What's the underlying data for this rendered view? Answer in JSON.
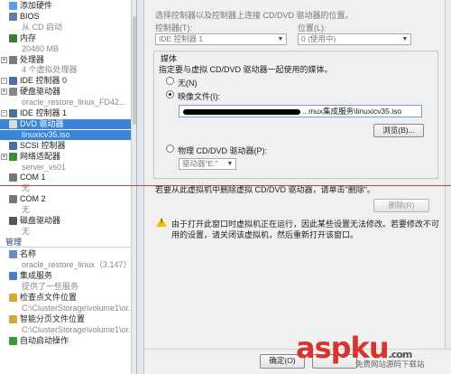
{
  "tree": {
    "items": [
      {
        "label": "添加硬件",
        "icon": "add-hardware-icon",
        "color": "#5aa0e6"
      },
      {
        "label": "BIOS",
        "icon": "bios-icon",
        "color": "#5c7ea8"
      },
      {
        "label": "从 CD 启动",
        "sub": true
      },
      {
        "label": "内存",
        "icon": "memory-icon",
        "color": "#3d7a3d"
      },
      {
        "label": "20480 MB",
        "sub": true
      },
      {
        "label": "处理器",
        "icon": "processor-icon",
        "color": "#7a7a7a",
        "exp": "+"
      },
      {
        "label": "4 个虚拟处理器",
        "sub": true
      },
      {
        "label": "IDE 控制器 0",
        "icon": "ide-controller-icon",
        "color": "#4a6fa0",
        "exp": "-"
      },
      {
        "label": "硬盘驱动器",
        "icon": "hard-drive-icon",
        "color": "#888888",
        "exp": "+"
      },
      {
        "label": "oracle_restore_linux_FD42...",
        "sub": true
      },
      {
        "label": "IDE 控制器 1",
        "icon": "ide-controller-icon",
        "color": "#4a6fa0",
        "exp": "-"
      },
      {
        "label": "DVD 驱动器",
        "icon": "dvd-drive-icon",
        "color": "#dcdcdc",
        "selected": true
      },
      {
        "label": "linuxicv35.iso",
        "sub": true,
        "selected": true
      },
      {
        "label": "SCSI 控制器",
        "icon": "scsi-controller-icon",
        "color": "#4a6fa0"
      },
      {
        "label": "网络适配器",
        "icon": "network-adapter-icon",
        "color": "#3a8a3a",
        "exp": "+"
      },
      {
        "label": "server_vs01",
        "sub": true
      },
      {
        "label": "COM 1",
        "icon": "com-port-icon",
        "color": "#777777"
      },
      {
        "label": "无",
        "sub": true
      },
      {
        "label": "COM 2",
        "icon": "com-port-icon",
        "color": "#777777"
      },
      {
        "label": "无",
        "sub": true
      },
      {
        "label": "磁盘驱动器",
        "icon": "floppy-drive-icon",
        "color": "#555555"
      },
      {
        "label": "无",
        "sub": true
      }
    ],
    "management_title": "管理",
    "management_items": [
      {
        "label": "名称",
        "icon": "name-icon",
        "color": "#6a8cc0"
      },
      {
        "label": "oracle_restore_linux（3.147）",
        "sub": true
      },
      {
        "label": "集成服务",
        "icon": "integration-services-icon",
        "color": "#4a80c8"
      },
      {
        "label": "提供了一些服务",
        "sub": true
      },
      {
        "label": "检查点文件位置",
        "icon": "checkpoint-folder-icon",
        "color": "#d8a93a"
      },
      {
        "label": "C:\\ClusterStorage\\volume1\\or...",
        "sub": true
      },
      {
        "label": "智能分页文件位置",
        "icon": "paging-folder-icon",
        "color": "#d8a93a"
      },
      {
        "label": "C:\\ClusterStorage\\volume1\\or...",
        "sub": true
      },
      {
        "label": "自动启动操作",
        "icon": "autostart-icon",
        "color": "#3a9a3a"
      }
    ]
  },
  "right": {
    "top_instruction": "选择控制器以及控制器上连接 CD/DVD 驱动器的位置。",
    "controller_label": "控制器(T):",
    "controller_value": "IDE 控制器 1",
    "location_label": "位置(L):",
    "location_value": "0 (使用中)",
    "media_title": "媒体",
    "media_instruction": "指定要与虚拟 CD/DVD 驱动器一起使用的媒体。",
    "radio_none": "无(N)",
    "radio_image": "映像文件(I):",
    "image_path": "...mux集成服务\\linuxicv35.iso",
    "browse_button": "浏览(B)...",
    "radio_physical": "物理 CD/DVD 驱动器(P):",
    "physical_value": "驱动器\"E:\"",
    "remove_hint": "若要从此虚拟机中删除虚拟 CD/DVD 驱动器，请单击\"删除\"。",
    "remove_button": "删除(R)",
    "warning_text_1": "由于打开此窗口时虚拟机正在运行，因此某些设置无法修改。若要修改不可",
    "warning_text_2": "用的设置，请关闭该虚拟机，然后重新打开该窗口。",
    "ok_button": "确定(O)"
  },
  "watermark": {
    "logo": "aspku",
    "logo_suffix": ".com",
    "caption": "免费网站源码下载站"
  }
}
